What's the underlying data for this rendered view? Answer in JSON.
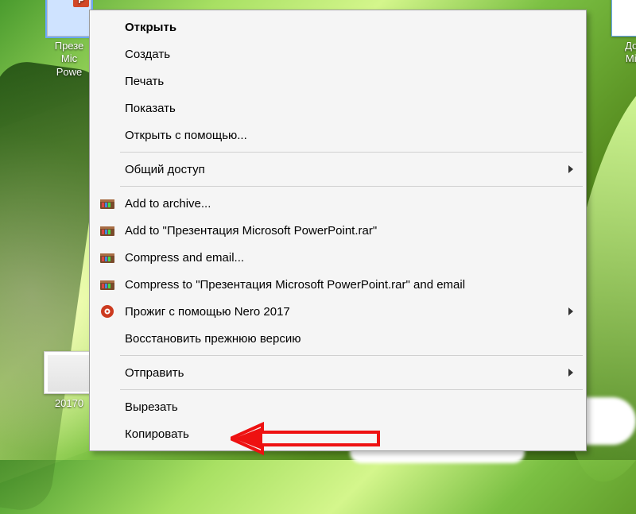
{
  "desktop": {
    "file1": {
      "label": "Презе\nMic\nPowe",
      "badge": "P"
    },
    "file2": {
      "label": "Док\nMic"
    },
    "folder1": {
      "label": "20170"
    }
  },
  "menu": {
    "open": "Открыть",
    "create": "Создать",
    "print": "Печать",
    "show": "Показать",
    "open_with": "Открыть с помощью...",
    "share": "Общий доступ",
    "add_archive": "Add to archive...",
    "add_named": "Add to \"Презентация Microsoft PowerPoint.rar\"",
    "compress_email": "Compress and email...",
    "compress_named_email": "Compress to \"Презентация Microsoft PowerPoint.rar\" and email",
    "nero": "Прожиг с помощью Nero 2017",
    "restore": "Восстановить прежнюю версию",
    "send_to": "Отправить",
    "cut": "Вырезать",
    "copy": "Копировать"
  }
}
